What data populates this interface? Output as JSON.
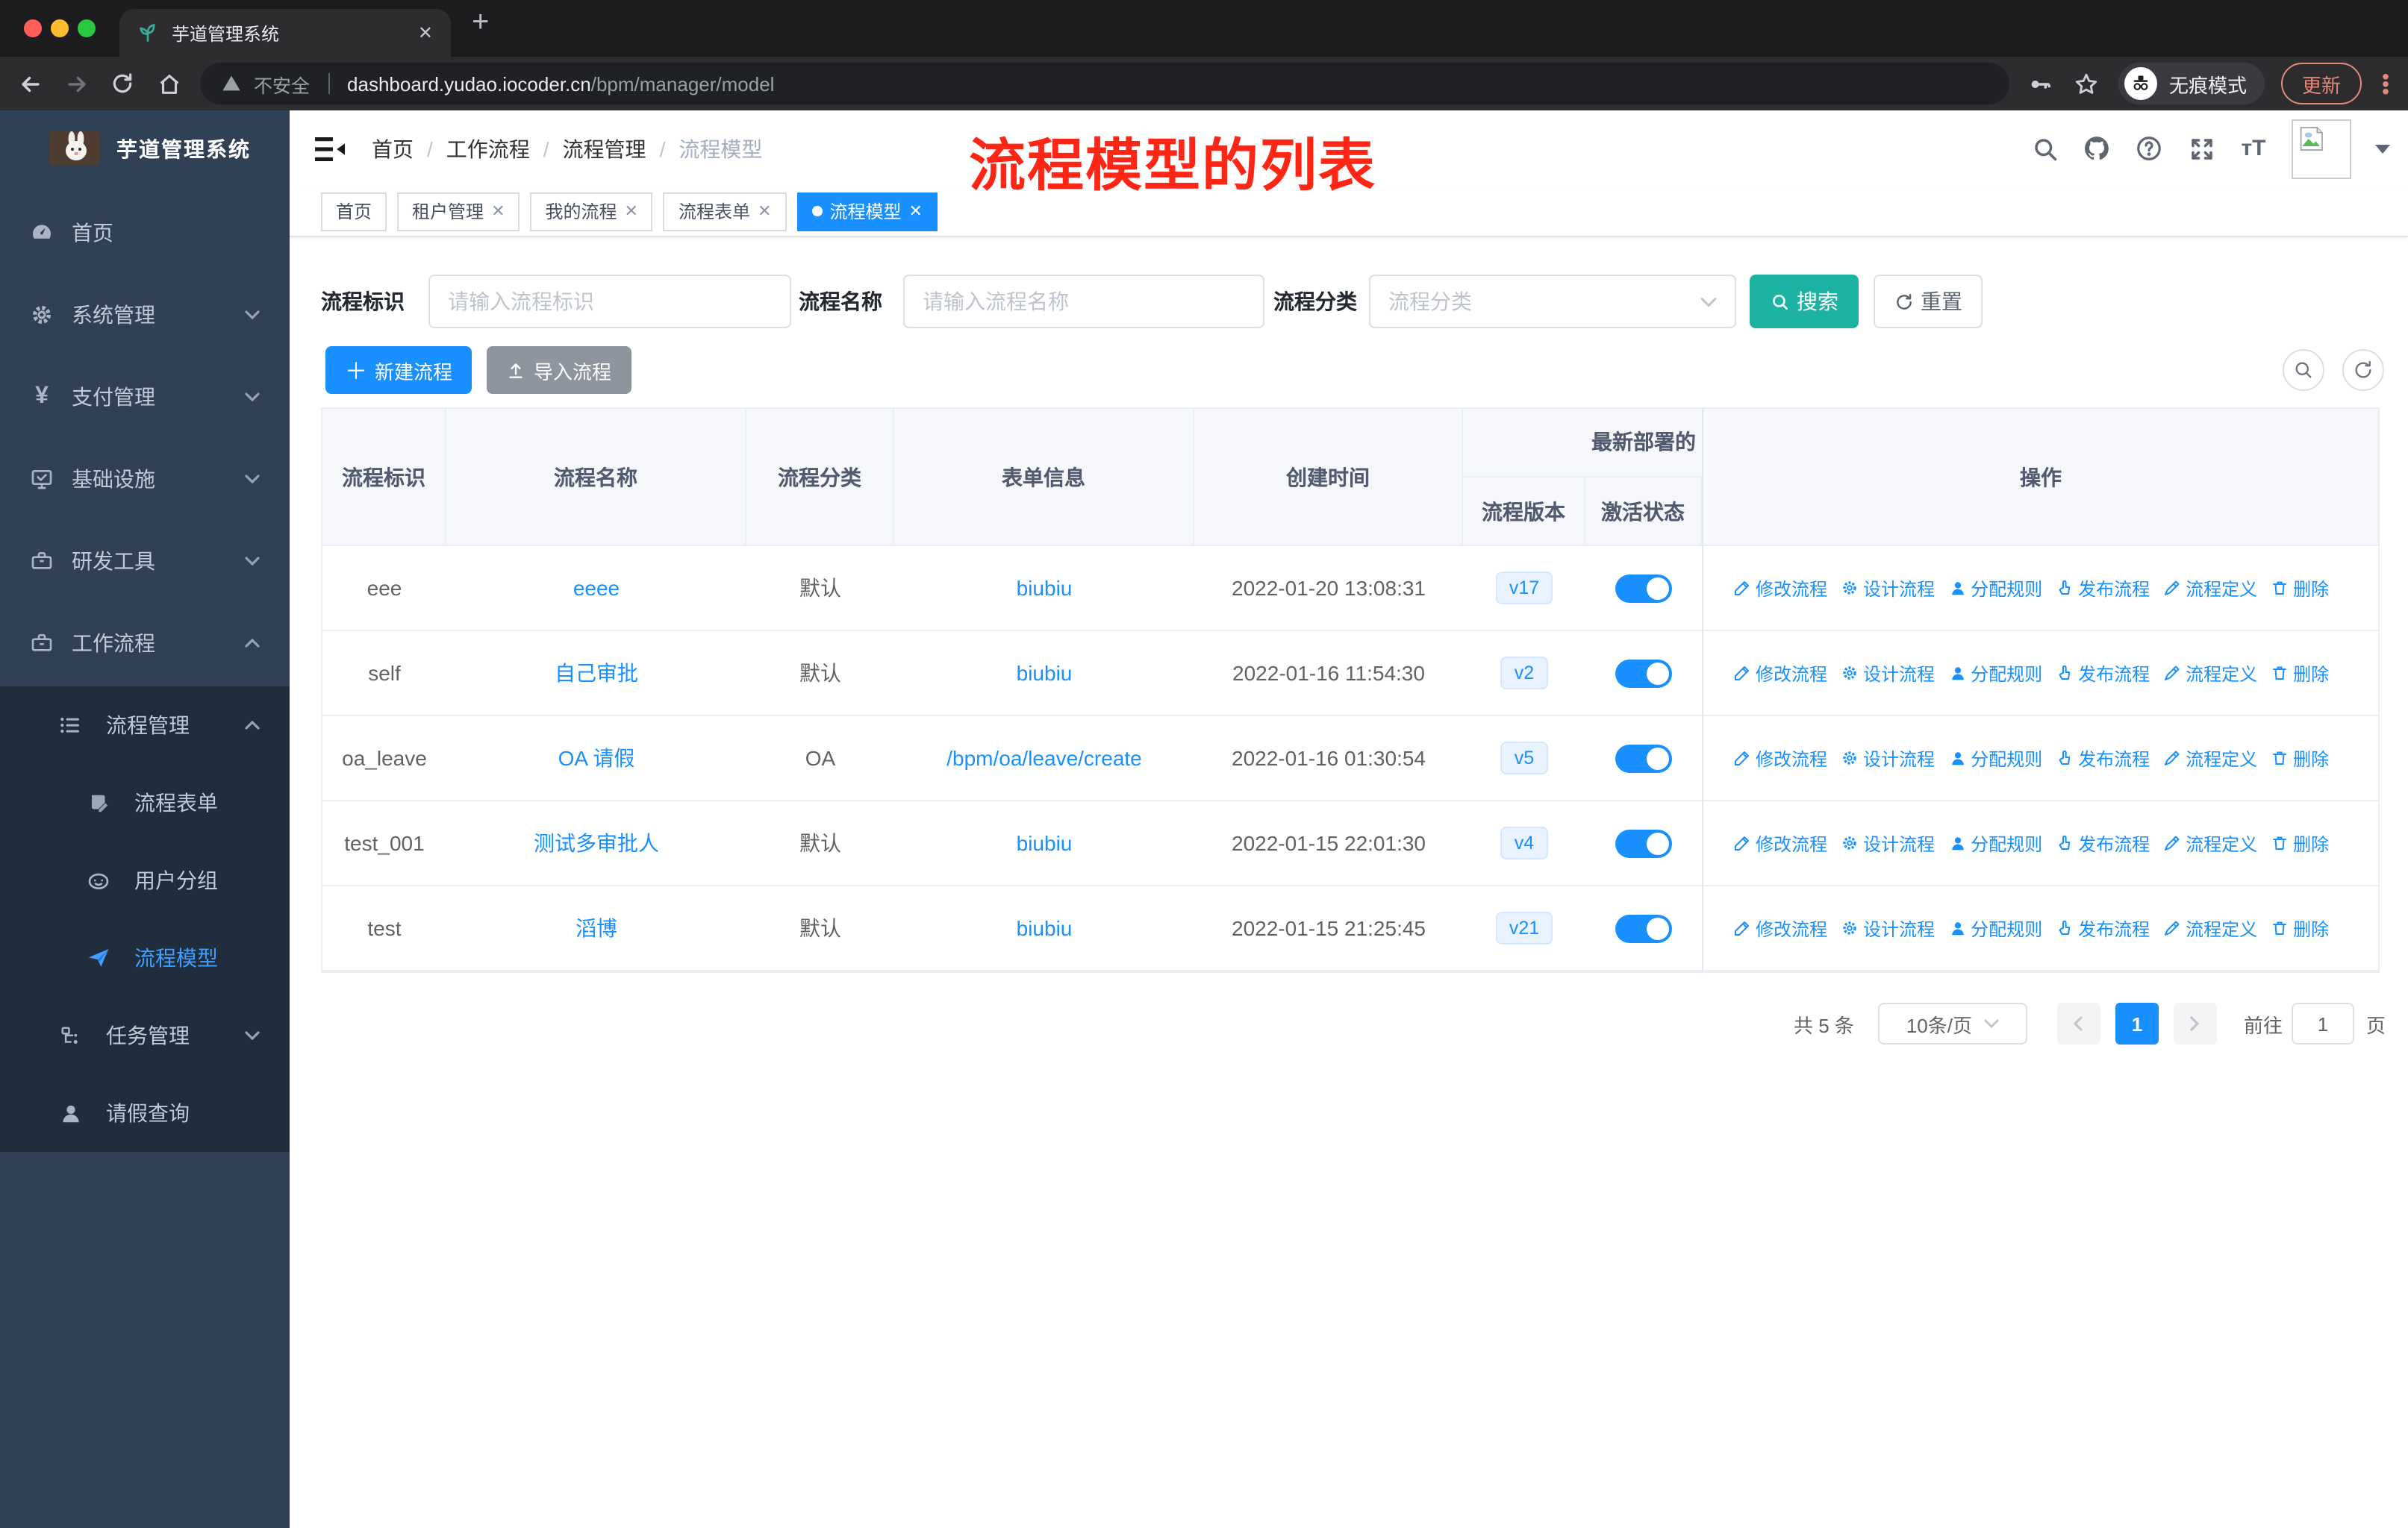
{
  "browser": {
    "tab_title": "芋道管理系统",
    "security_label": "不安全",
    "url_host": "dashboard.yudao.iocoder.cn",
    "url_path": "/bpm/manager/model",
    "incognito_label": "无痕模式",
    "update_label": "更新"
  },
  "sidebar": {
    "title": "芋道管理系统",
    "items": [
      {
        "label": "首页"
      },
      {
        "label": "系统管理"
      },
      {
        "label": "支付管理"
      },
      {
        "label": "基础设施"
      },
      {
        "label": "研发工具"
      },
      {
        "label": "工作流程"
      },
      {
        "label": "流程管理"
      },
      {
        "label": "流程表单"
      },
      {
        "label": "用户分组"
      },
      {
        "label": "流程模型"
      },
      {
        "label": "任务管理"
      },
      {
        "label": "请假查询"
      }
    ]
  },
  "navbar": {
    "breadcrumb": [
      "首页",
      "工作流程",
      "流程管理",
      "流程模型"
    ]
  },
  "annotation": {
    "text": "流程模型的列表",
    "color": "#ff2616"
  },
  "tabs": [
    {
      "label": "首页"
    },
    {
      "label": "租户管理"
    },
    {
      "label": "我的流程"
    },
    {
      "label": "流程表单"
    },
    {
      "label": "流程模型"
    }
  ],
  "filters": {
    "id_label": "流程标识",
    "id_placeholder": "请输入流程标识",
    "name_label": "流程名称",
    "name_placeholder": "请输入流程名称",
    "category_label": "流程分类",
    "category_placeholder": "流程分类",
    "search_label": "搜索",
    "reset_label": "重置"
  },
  "toolbar": {
    "create_label": "新建流程",
    "import_label": "导入流程"
  },
  "table": {
    "headers": {
      "id": "流程标识",
      "name": "流程名称",
      "category": "流程分类",
      "form": "表单信息",
      "created": "创建时间",
      "deploy_group": "最新部署的",
      "version": "流程版本",
      "active": "激活状态",
      "actions": "操作"
    },
    "action_labels": [
      "修改流程",
      "设计流程",
      "分配规则",
      "发布流程",
      "流程定义",
      "删除"
    ],
    "rows": [
      {
        "id": "eee",
        "name": "eeee",
        "category": "默认",
        "form": "biubiu",
        "created": "2022-01-20 13:08:31",
        "version": "v17",
        "active": true
      },
      {
        "id": "self",
        "name": "自己审批",
        "category": "默认",
        "form": "biubiu",
        "created": "2022-01-16 11:54:30",
        "version": "v2",
        "active": true
      },
      {
        "id": "oa_leave",
        "name": "OA 请假",
        "category": "OA",
        "form": "/bpm/oa/leave/create",
        "created": "2022-01-16 01:30:54",
        "version": "v5",
        "active": true
      },
      {
        "id": "test_001",
        "name": "测试多审批人",
        "category": "默认",
        "form": "biubiu",
        "created": "2022-01-15 22:01:30",
        "version": "v4",
        "active": true
      },
      {
        "id": "test",
        "name": "滔博",
        "category": "默认",
        "form": "biubiu",
        "created": "2022-01-15 21:25:45",
        "version": "v21",
        "active": true
      }
    ]
  },
  "pagination": {
    "total": "共 5 条",
    "per_page": "10条/页",
    "page": "1",
    "goto_label": "前往",
    "page_unit": "页"
  },
  "colors": {
    "primary_blue": "#1890ff",
    "search_teal": "#1db3a3",
    "sidebar_bg": "#304156",
    "submenu_bg": "#1f2d3d",
    "annotation_red": "#ff2616",
    "active_menu": "#409eff"
  }
}
